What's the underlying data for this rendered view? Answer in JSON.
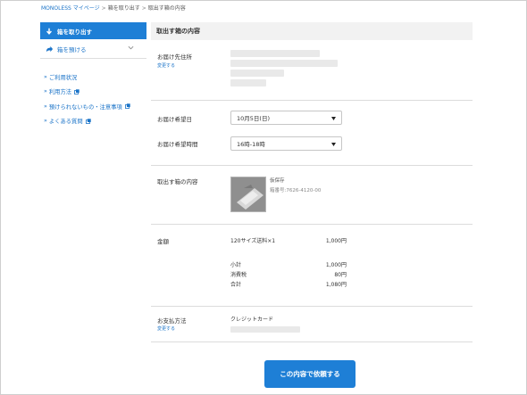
{
  "breadcrumb": {
    "home": "MONOLESS マイページ",
    "step": "箱を取り出す",
    "current": "取出す箱の内容",
    "separator": ">"
  },
  "sidebar": {
    "primary_label": "箱を取り出す",
    "secondary_label": "箱を預ける",
    "links": [
      {
        "label": "ご利用状況",
        "external": false
      },
      {
        "label": "利用方法",
        "external": true
      },
      {
        "label": "預けられないもの・注意事項",
        "external": true
      },
      {
        "label": "よくある質問",
        "external": true
      }
    ],
    "bullet": "»"
  },
  "main": {
    "header": "取出す箱の内容",
    "address": {
      "label": "お届け先住所",
      "change": "変更する"
    },
    "delivery_date": {
      "label": "お届け希望日",
      "value": "10月5日(日)"
    },
    "delivery_time": {
      "label": "お届け希望時間",
      "value": "16時-18時"
    },
    "box_contents": {
      "label": "取出す箱の内容",
      "item_name": "仮保存",
      "item_number": "箱番号:7626-4120-00"
    },
    "amount": {
      "label": "金額",
      "line_item": "120サイズ送料×1",
      "line_value": "1,000円",
      "subtotal_label": "小計",
      "subtotal_value": "1,000円",
      "tax_label": "消費税",
      "tax_value": "80円",
      "total_label": "合計",
      "total_value": "1,080円"
    },
    "payment": {
      "label": "お支払方法",
      "method": "クレジットカード",
      "change": "変更する"
    }
  },
  "submit_label": "この内容で依頼する",
  "colors": {
    "accent": "#1e7fd6",
    "link": "#1a73c8",
    "header_bg": "#f2f2f2"
  }
}
